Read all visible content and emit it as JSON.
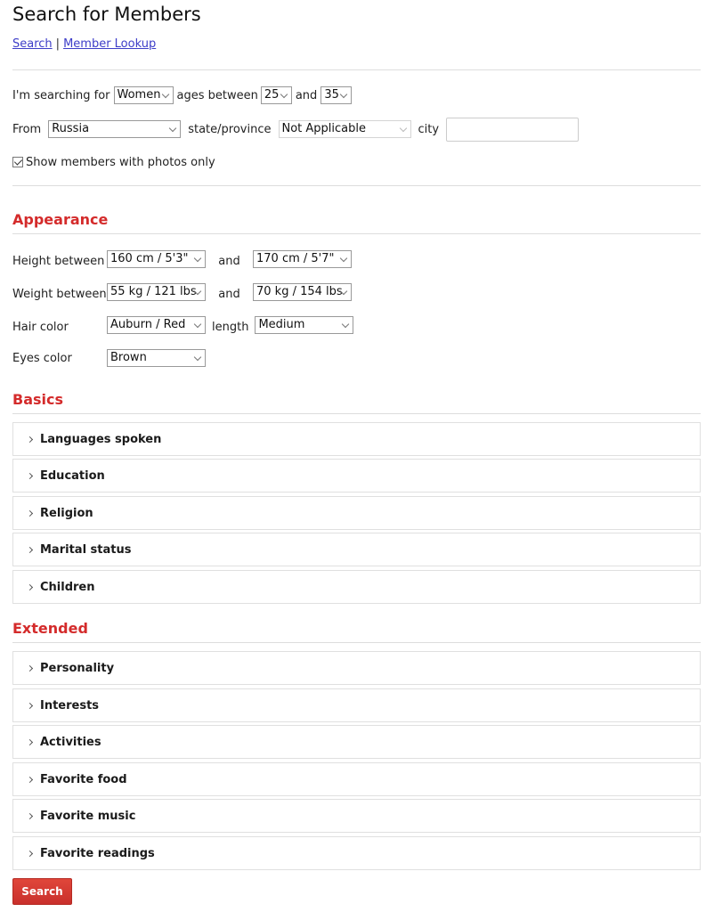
{
  "header": {
    "title": "Search for Members",
    "nav": [
      {
        "label": "Search"
      },
      {
        "label": "Member Lookup"
      }
    ],
    "nav_separator": "|"
  },
  "basic_search": {
    "searching_for_label": "I'm searching for",
    "gender_value": "Women",
    "ages_between_label": "ages between",
    "age_min_value": "25",
    "and_label": "and",
    "age_max_value": "35",
    "from_label": "From",
    "country_value": "Russia",
    "state_label": "state/province",
    "state_value": "Not Applicable",
    "city_label": "city",
    "city_value": "",
    "photos_only_label": "Show members with photos only",
    "photos_only_checked": true
  },
  "appearance": {
    "title": "Appearance",
    "height_label": "Height between",
    "height_min_value": "160 cm / 5'3\"",
    "height_and_label": "and",
    "height_max_value": "170 cm / 5'7\"",
    "weight_label": "Weight between",
    "weight_min_value": "55 kg / 121 lbs",
    "weight_and_label": "and",
    "weight_max_value": "70 kg / 154 lbs",
    "hair_color_label": "Hair color",
    "hair_color_value": "Auburn / Red",
    "length_label": "length",
    "length_value": "Medium",
    "eyes_color_label": "Eyes color",
    "eyes_color_value": "Brown"
  },
  "basics": {
    "title": "Basics",
    "panels": [
      {
        "label": "Languages spoken"
      },
      {
        "label": "Education"
      },
      {
        "label": "Religion"
      },
      {
        "label": "Marital status"
      },
      {
        "label": "Children"
      }
    ]
  },
  "extended": {
    "title": "Extended",
    "panels": [
      {
        "label": "Personality"
      },
      {
        "label": "Interests"
      },
      {
        "label": "Activities"
      },
      {
        "label": "Favorite food"
      },
      {
        "label": "Favorite music"
      },
      {
        "label": "Favorite readings"
      }
    ]
  },
  "actions": {
    "search_label": "Search"
  },
  "colors": {
    "accent": "#d42b2b",
    "link": "#3d3dc8",
    "button": "#d33a30"
  }
}
